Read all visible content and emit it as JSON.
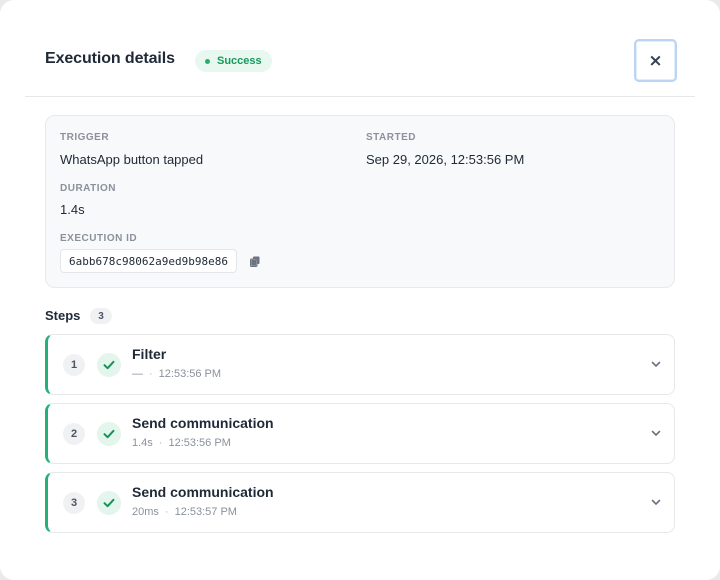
{
  "header": {
    "title": "Execution details",
    "status_badge": "Success",
    "close_glyph": "×"
  },
  "summary": {
    "trigger_label": "TRIGGER",
    "trigger_value": "WhatsApp button tapped",
    "started_label": "STARTED",
    "started_value": "Sep 29, 2026, 12:53:56 PM",
    "duration_label": "DURATION",
    "duration_value": "1.4s",
    "execution_id_label": "EXECUTION ID",
    "execution_id_value": "6abb678c98062a9ed9b98e86"
  },
  "steps": {
    "title": "Steps",
    "count": "3",
    "items": [
      {
        "number": "1",
        "name": "Filter",
        "duration": "—",
        "time": "12:53:56 PM"
      },
      {
        "number": "2",
        "name": "Send communication",
        "duration": "1.4s",
        "time": "12:53:56 PM"
      },
      {
        "number": "3",
        "name": "Send communication",
        "duration": "20ms",
        "time": "12:53:57 PM"
      }
    ]
  },
  "colors": {
    "success_green": "#25b07a",
    "badge_bg": "#e8f7ef",
    "badge_text": "#159a5c"
  },
  "icons": {
    "close": "close-icon",
    "copy": "copy-icon",
    "check": "check-icon",
    "chevron": "chevron-down-icon"
  }
}
